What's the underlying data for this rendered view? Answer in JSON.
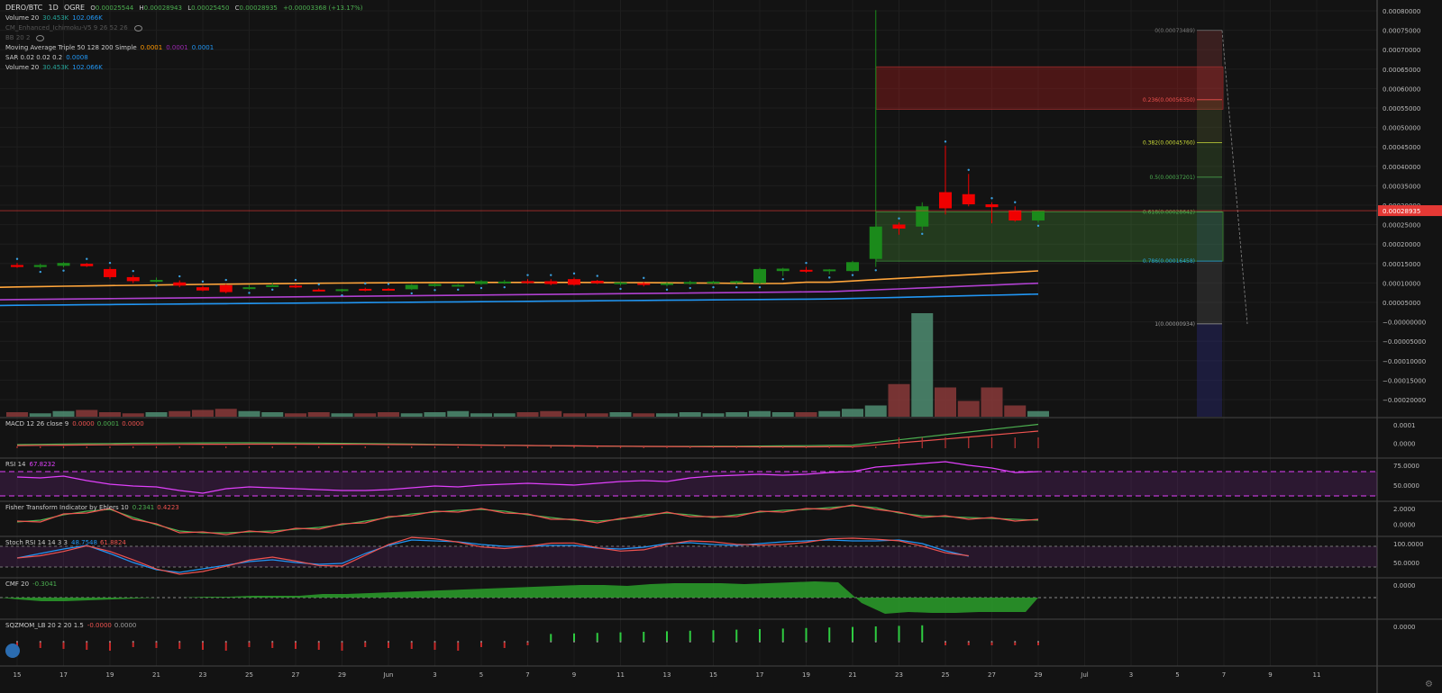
{
  "header": {
    "symbol": "DERO/BTC",
    "interval": "1D",
    "exchange": "OGRE",
    "ohlc": {
      "o_label": "O",
      "o_value": "0.00025544",
      "h_label": "H",
      "h_value": "0.00028943",
      "l_label": "L",
      "l_value": "0.00025450",
      "c_label": "C",
      "c_value": "0.00028935",
      "change": "+0.00003368 (+13.17%)"
    }
  },
  "legend": [
    {
      "name": "Volume 20",
      "values": [
        "30.453K",
        "102.066K"
      ],
      "colors": [
        "#26a69a",
        "#2196f3"
      ]
    },
    {
      "name": "CM_Enhanced_Ichimoku-V5 9 26 52 26",
      "values": [],
      "colors": [],
      "dim": true
    },
    {
      "name": "BB 20 2",
      "values": [],
      "colors": [],
      "dim": true
    },
    {
      "name": "Moving Average Triple 50 128 200 Simple",
      "values": [
        "0.0001",
        "0.0001",
        "0.0001"
      ],
      "colors": [
        "#ff9800",
        "#9c27b0",
        "#2196f3"
      ]
    },
    {
      "name": "SAR 0.02 0.02 0.2",
      "values": [
        "0.0008"
      ],
      "colors": [
        "#2196f3"
      ]
    },
    {
      "name": "Volume 20",
      "values": [
        "30.453K",
        "102.066K"
      ],
      "colors": [
        "#26a69a",
        "#2196f3"
      ]
    }
  ],
  "price_axis": {
    "labels": [
      "0.00080000",
      "0.00075000",
      "0.00070000",
      "0.00065000",
      "0.00060000",
      "0.00055000",
      "0.00050000",
      "0.00045000",
      "0.00040000",
      "0.00035000",
      "0.00030000",
      "0.00025000",
      "0.00020000",
      "0.00015000",
      "0.00010000",
      "0.00005000",
      "−0.00000000",
      "−0.00005000",
      "−0.00010000",
      "−0.00015000",
      "−0.00020000"
    ],
    "current_price": "0.00028935",
    "current_price_color": "#e53935"
  },
  "fib": {
    "levels": [
      {
        "label": "0(0.00073489)",
        "color": "#787878",
        "value": 0.00073489
      },
      {
        "label": "0.236(0.00056350)",
        "color": "#ef5350",
        "value": 0.0005635
      },
      {
        "label": "0.382(0.00045760)",
        "color": "#cddc39",
        "value": 0.0004576
      },
      {
        "label": "0.5(0.00037201)",
        "color": "#4caf50",
        "value": 0.00037201
      },
      {
        "label": "0.618(0.00028642)",
        "color": "#4caf50",
        "value": 0.00028642
      },
      {
        "label": "0.786(0.00016458)",
        "color": "#26a6da",
        "value": 0.00016458
      },
      {
        "label": "1(0.00000934)",
        "color": "#9e9e9e",
        "value": 9.34e-06
      }
    ]
  },
  "panes": [
    {
      "name": "MACD 12 26 close 9",
      "values": [
        "0.0000",
        "0.0001",
        "0.0000"
      ],
      "colors": [
        "#ef5350",
        "#4caf50",
        "#ef5350"
      ],
      "axis": [
        "0.0001",
        "0.0000"
      ]
    },
    {
      "name": "RSI 14",
      "values": [
        "67.8232"
      ],
      "colors": [
        "#e040fb"
      ],
      "axis": [
        "75.0000",
        "50.0000"
      ]
    },
    {
      "name": "Fisher Transform Indicator by Ehlers 10",
      "values": [
        "0.2341",
        "0.4223"
      ],
      "colors": [
        "#4caf50",
        "#ef5350"
      ],
      "axis": [
        "2.0000",
        "0.0000"
      ]
    },
    {
      "name": "Stoch RSI 14 14 3 3",
      "values": [
        "48.7548",
        "61.8824"
      ],
      "colors": [
        "#2196f3",
        "#ef5350"
      ],
      "axis": [
        "100.0000",
        "50.0000"
      ]
    },
    {
      "name": "CMF 20",
      "values": [
        "-0.3041"
      ],
      "colors": [
        "#4caf50"
      ],
      "axis": [
        "0.0000"
      ]
    },
    {
      "name": "SQZMOM_LB 20 2 20 1.5",
      "values": [
        "-0.0000",
        "0.0000"
      ],
      "colors": [
        "#ef5350",
        "#9e9e9e"
      ],
      "axis": [
        "0.0000"
      ]
    }
  ],
  "time_axis": [
    "15",
    "17",
    "19",
    "21",
    "23",
    "25",
    "27",
    "29",
    "Jun",
    "3",
    "5",
    "7",
    "9",
    "11",
    "13",
    "15",
    "17",
    "19",
    "21",
    "23",
    "25",
    "27",
    "29",
    "Jul",
    "3",
    "5",
    "7",
    "9",
    "11"
  ],
  "colors": {
    "up": "#1b8a1b",
    "down": "#f00000",
    "background": "#131313"
  },
  "chart_data": {
    "type": "candlestick",
    "title": "",
    "series": [
      {
        "name": "candles",
        "values": [
          [
            0.000155,
            0.00016,
            0.000148,
            0.00015
          ],
          [
            0.00015,
            0.000158,
            0.000146,
            0.000155
          ],
          [
            0.000153,
            0.000162,
            0.000149,
            0.00016
          ],
          [
            0.000158,
            0.00016,
            0.00015,
            0.000152
          ],
          [
            0.000145,
            0.00015,
            0.00012,
            0.000125
          ],
          [
            0.000125,
            0.00013,
            0.00011,
            0.000115
          ],
          [
            0.000118,
            0.000124,
            0.000112,
            0.000118
          ],
          [
            0.000112,
            0.000117,
            0.0001,
            0.000104
          ],
          [
            0.0001,
            0.000104,
            9e-05,
            9.2e-05
          ],
          [
            0.000105,
            0.000108,
            8.5e-05,
            8.8e-05
          ],
          [
            9.8e-05,
            0.000106,
            9.4e-05,
            0.0001
          ],
          [
            0.000105,
            0.00011,
            0.000102,
            0.000105
          ],
          [
            0.000104,
            0.000108,
            9.8e-05,
            0.000101
          ],
          [
            9.4e-05,
            9.7e-05,
            9e-05,
            9.2e-05
          ],
          [
            9.2e-05,
            9.6e-05,
            8.8e-05,
            9.5e-05
          ],
          [
            9.6e-05,
            9.9e-05,
            9e-05,
            9.2e-05
          ],
          [
            9.6e-05,
            9.8e-05,
            9.2e-05,
            9.4e-05
          ],
          [
            9.5e-05,
            0.000108,
            9.3e-05,
            0.000106
          ],
          [
            0.000103,
            0.00011,
            0.000101,
            0.000108
          ],
          [
            0.000105,
            0.000108,
            0.000102,
            0.000106
          ],
          [
            0.000108,
            0.000118,
            0.000106,
            0.000115
          ],
          [
            0.000112,
            0.000118,
            0.000108,
            0.000114
          ],
          [
            0.000115,
            0.00012,
            0.000108,
            0.000112
          ],
          [
            0.000115,
            0.00012,
            0.000105,
            0.000108
          ],
          [
            0.00012,
            0.000124,
            0.000104,
            0.000106
          ],
          [
            0.000116,
            0.000118,
            0.000108,
            0.00011
          ],
          [
            0.000108,
            0.000114,
            0.000104,
            0.000112
          ],
          [
            0.00011,
            0.000113,
            0.000102,
            0.000107
          ],
          [
            0.000108,
            0.000112,
            0.000102,
            0.00011
          ],
          [
            0.00011,
            0.000116,
            0.000106,
            0.000113
          ],
          [
            0.000112,
            0.000116,
            0.000108,
            0.000114
          ],
          [
            0.000112,
            0.000116,
            0.000108,
            0.000115
          ],
          [
            0.00011,
            0.000148,
            0.000108,
            0.000145
          ],
          [
            0.00014,
            0.000148,
            0.000128,
            0.000146
          ],
          [
            0.000143,
            0.00015,
            0.000136,
            0.00014
          ],
          [
            0.00014,
            0.000145,
            0.000132,
            0.000144
          ],
          [
            0.00014,
            0.000165,
            0.000138,
            0.000162
          ],
          [
            0.00017,
            0.000785,
            0.00015,
            0.00025
          ],
          [
            0.000255,
            0.00026,
            0.00023,
            0.000245
          ],
          [
            0.00025,
            0.00031,
            0.00024,
            0.0003
          ],
          [
            0.000335,
            0.00045,
            0.00028,
            0.000295
          ],
          [
            0.00033,
            0.00038,
            0.0003,
            0.000305
          ],
          [
            0.000305,
            0.00031,
            0.000258,
            0.000298
          ],
          [
            0.00029,
            0.0003,
            0.000262,
            0.000265
          ],
          [
            0.000265,
            0.00029,
            0.00026,
            0.000289
          ]
        ]
      }
    ],
    "volume": [
      4,
      3,
      5,
      6,
      4,
      3,
      4,
      5,
      6,
      7,
      5,
      4,
      3,
      4,
      3,
      3,
      4,
      3,
      4,
      5,
      3,
      3,
      4,
      5,
      3,
      3,
      4,
      3,
      3,
      4,
      3,
      4,
      5,
      4,
      4,
      5,
      7,
      10,
      29,
      92,
      26,
      14,
      26,
      10,
      5
    ],
    "ylim": [
      -0.00022,
      0.00081
    ]
  }
}
